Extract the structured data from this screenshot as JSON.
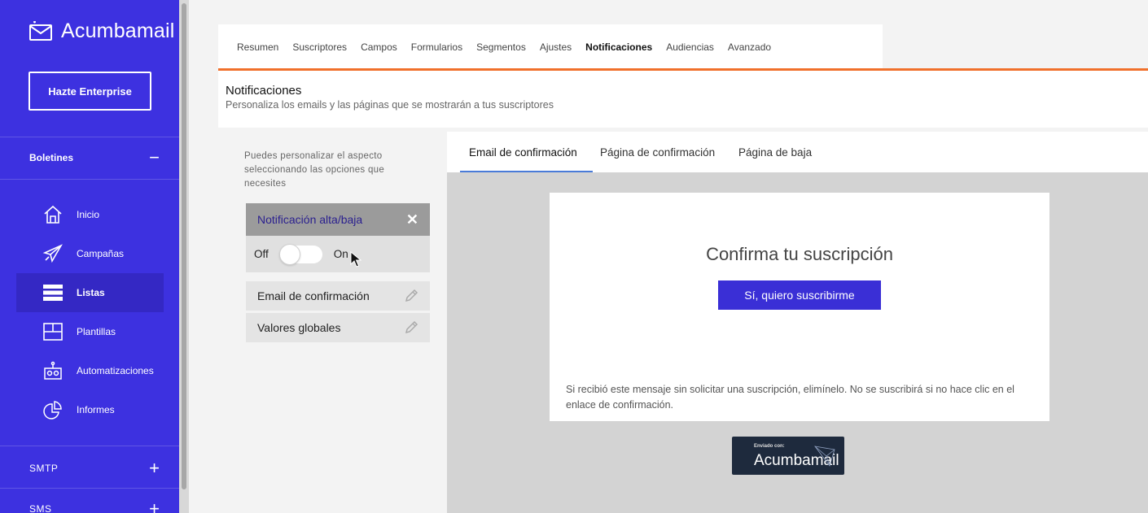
{
  "sidebar": {
    "brand": "Acumbamail",
    "enterprise_button": "Hazte Enterprise",
    "sections": {
      "boletines": {
        "label": "Boletines",
        "sign": "−"
      },
      "smtp": {
        "label": "SMTP",
        "sign": "+"
      },
      "sms": {
        "label": "SMS",
        "sign": "+"
      }
    },
    "items": [
      {
        "label": "Inicio",
        "icon": "home-icon"
      },
      {
        "label": "Campañas",
        "icon": "paper-plane-icon"
      },
      {
        "label": "Listas",
        "icon": "list-icon",
        "active": true
      },
      {
        "label": "Plantillas",
        "icon": "template-icon"
      },
      {
        "label": "Automatizaciones",
        "icon": "robot-icon"
      },
      {
        "label": "Informes",
        "icon": "pie-chart-icon"
      }
    ]
  },
  "tabs": [
    {
      "label": "Resumen"
    },
    {
      "label": "Suscriptores"
    },
    {
      "label": "Campos"
    },
    {
      "label": "Formularios"
    },
    {
      "label": "Segmentos"
    },
    {
      "label": "Ajustes"
    },
    {
      "label": "Notificaciones",
      "active": true
    },
    {
      "label": "Audiencias"
    },
    {
      "label": "Avanzado"
    }
  ],
  "header": {
    "title": "Notificaciones",
    "subtitle": "Personaliza los emails y las páginas que se mostrarán a tus suscriptores"
  },
  "left_panel": {
    "helper": "Puedes personalizar el aspecto seleccionando las opciones que necesites",
    "notification_header": "Notificación alta/baja",
    "toggle_off": "Off",
    "toggle_on": "On",
    "toggle_state": "off",
    "items": [
      {
        "label": "Email de confirmación"
      },
      {
        "label": "Valores globales"
      }
    ]
  },
  "preview": {
    "tabs": [
      {
        "label": "Email de confirmación",
        "active": true
      },
      {
        "label": "Página de confirmación"
      },
      {
        "label": "Página de baja"
      }
    ],
    "email_title": "Confirma tu suscripción",
    "confirm_button": "Sí, quiero suscribirme",
    "disclaimer": "Si recibió este mensaje sin solicitar una suscripción, elimínelo. No se suscribirá si no hace clic en el enlace de confirmación.",
    "badge_small": "Enviado con:",
    "badge_brand": "Acumbamail"
  },
  "colors": {
    "sidebar": "#3d31e0",
    "accent_orange": "#f0702b",
    "button": "#3a2fd6",
    "badge": "#1e2a3d"
  }
}
